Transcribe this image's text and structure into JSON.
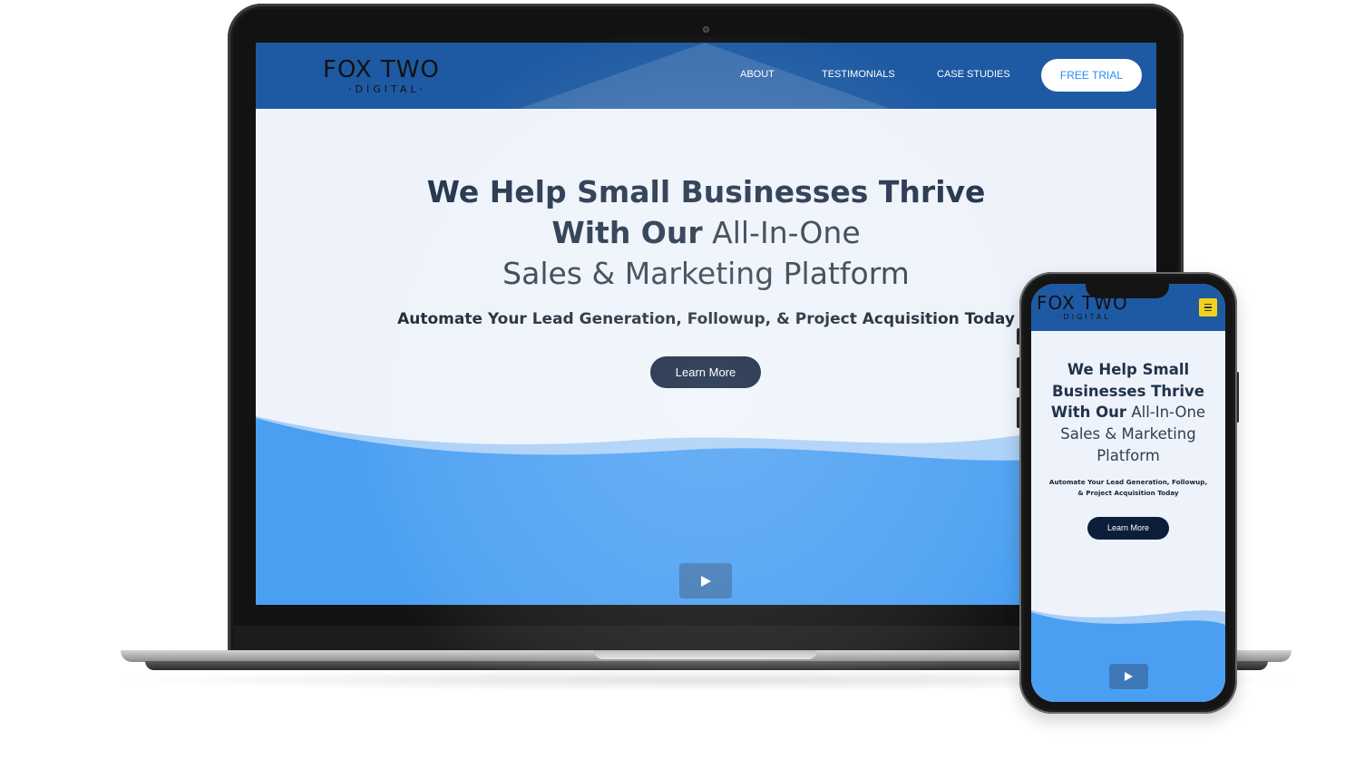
{
  "brand": {
    "logo_main": "FOX TWO",
    "logo_sub": "·DIGITAL·"
  },
  "nav": {
    "about": "ABOUT",
    "testimonials": "TESTIMONIALS",
    "case_studies": "CASE STUDIES",
    "free_trial": "FREE TRIAL"
  },
  "hero": {
    "line1": "We Help Small Businesses Thrive",
    "line2_bold": "With Our",
    "line2_normal": "All-In-One",
    "line3": "Sales & Marketing Platform",
    "tagline": "Automate Your Lead Generation, Followup, & Project Acquisition Today",
    "cta": "Learn More"
  },
  "mobile_hero": {
    "line1": "We Help Small",
    "line2": "Businesses Thrive",
    "line3_bold": "With Our",
    "line3_normal": "All-In-One",
    "line4": "Sales & Marketing",
    "line5": "Platform",
    "tagline_1": "Automate Your Lead Generation, Followup,",
    "tagline_2": "& Project Acquisition Today",
    "cta": "Learn More"
  },
  "icons": {
    "menu": "hamburger-menu-icon",
    "play": "play-icon"
  },
  "colors": {
    "header_blue": "#1e5aa3",
    "hero_bg": "#eef3fb",
    "wave_blue": "#4a9ff2",
    "wave_light": "#a9cff8",
    "button_dark": "#0c1e3a",
    "cta_text": "#2a8ef0",
    "menu_yellow": "#f2d21b"
  }
}
